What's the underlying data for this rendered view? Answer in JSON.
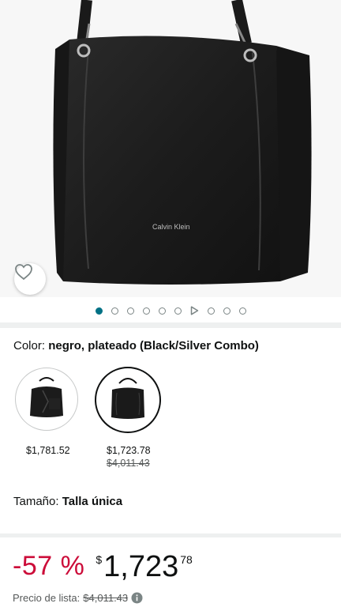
{
  "product": {
    "brand_print": "Calvin Klein"
  },
  "gallery": {
    "image_count": 10,
    "active_index": 0,
    "video_index": 6
  },
  "color": {
    "label": "Color: ",
    "value": "negro, plateado (Black/Silver Combo)"
  },
  "variants": [
    {
      "price": "$1,781.52",
      "list_price": ""
    },
    {
      "price": "$1,723.78",
      "list_price": "$4,011.43"
    }
  ],
  "size": {
    "label": "Tamaño: ",
    "value": "Talla única"
  },
  "deal": {
    "discount": "-57 %",
    "currency": "$",
    "price_whole": "1,723",
    "price_fraction": "78"
  },
  "list_price": {
    "label": "Precio de lista:",
    "value": "$4,011.43"
  },
  "colors": {
    "accent": "#007185",
    "discount": "#cc0c39",
    "separator": "#eef0f0"
  }
}
